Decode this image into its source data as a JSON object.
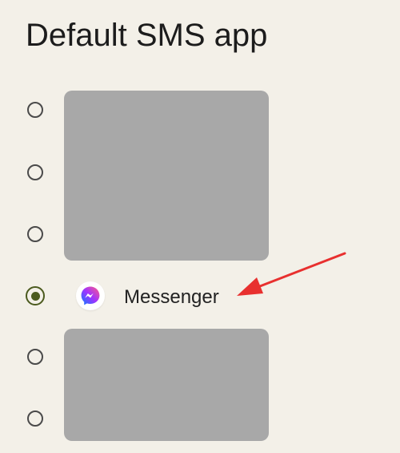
{
  "header": {
    "title": "Default SMS app"
  },
  "options": [
    {
      "selected": false,
      "redacted": true
    },
    {
      "selected": false,
      "redacted": true
    },
    {
      "selected": false,
      "redacted": true
    },
    {
      "selected": true,
      "label": "Messenger",
      "icon": "messenger-icon"
    },
    {
      "selected": false,
      "redacted": true
    },
    {
      "selected": false,
      "redacted": true
    }
  ],
  "colors": {
    "background": "#f3f0e8",
    "radio_selected": "#4b5a1e",
    "redaction": "#a8a8a8",
    "annotation_arrow": "#e8302f"
  }
}
